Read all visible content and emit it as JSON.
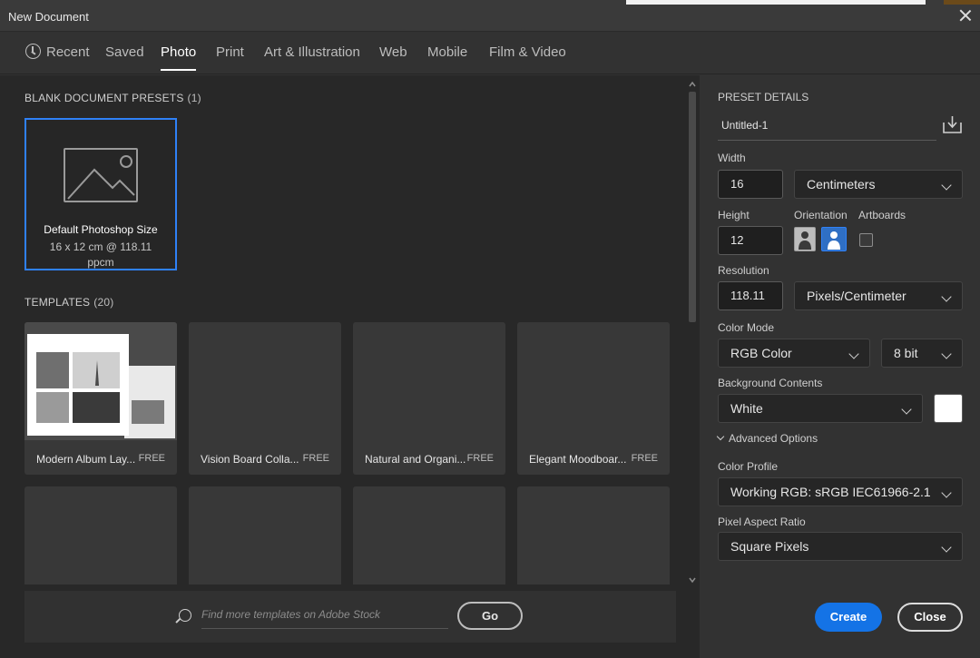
{
  "window": {
    "title": "New Document"
  },
  "tabs": [
    {
      "label": "Recent"
    },
    {
      "label": "Saved"
    },
    {
      "label": "Photo"
    },
    {
      "label": "Print"
    },
    {
      "label": "Art & Illustration"
    },
    {
      "label": "Web"
    },
    {
      "label": "Mobile"
    },
    {
      "label": "Film & Video"
    }
  ],
  "active_tab": "Photo",
  "presets": {
    "heading": "BLANK DOCUMENT PRESETS",
    "count": "(1)",
    "items": [
      {
        "name": "Default Photoshop Size",
        "desc": "16 x 12 cm @ 118.11 ppcm"
      }
    ]
  },
  "templates": {
    "heading": "TEMPLATES",
    "count": "(20)",
    "items": [
      {
        "name": "Modern Album Lay...",
        "badge": "FREE"
      },
      {
        "name": "Vision Board Colla...",
        "badge": "FREE"
      },
      {
        "name": "Natural and Organi...",
        "badge": "FREE"
      },
      {
        "name": "Elegant Moodboar...",
        "badge": "FREE"
      }
    ]
  },
  "search": {
    "placeholder": "Find more templates on Adobe Stock",
    "go_label": "Go"
  },
  "details": {
    "heading": "PRESET DETAILS",
    "doc_name": "Untitled-1",
    "width_label": "Width",
    "width_value": "16",
    "width_unit": "Centimeters",
    "height_label": "Height",
    "height_value": "12",
    "orientation_label": "Orientation",
    "artboards_label": "Artboards",
    "artboards_checked": false,
    "resolution_label": "Resolution",
    "resolution_value": "118.11",
    "resolution_unit": "Pixels/Centimeter",
    "color_mode_label": "Color Mode",
    "color_mode": "RGB Color",
    "bit_depth": "8 bit",
    "bg_label": "Background Contents",
    "bg_value": "White",
    "bg_swatch": "#ffffff",
    "advanced_label": "Advanced Options",
    "profile_label": "Color Profile",
    "profile_value": "Working RGB: sRGB IEC61966-2.1",
    "aspect_label": "Pixel Aspect Ratio",
    "aspect_value": "Square Pixels"
  },
  "buttons": {
    "create": "Create",
    "close": "Close"
  },
  "colors": {
    "accent": "#1473e6",
    "selection": "#2f81f7"
  }
}
